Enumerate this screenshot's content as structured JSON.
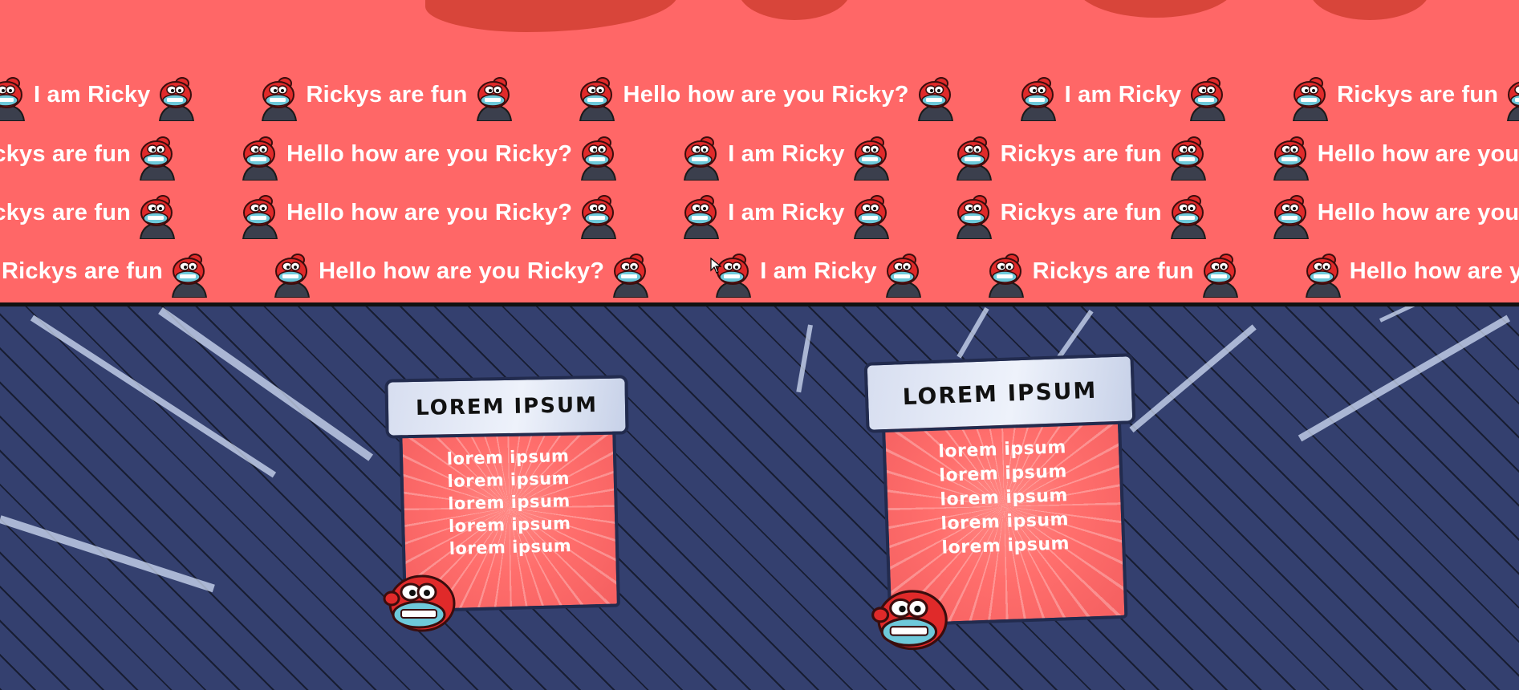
{
  "banner": {
    "phrases": [
      "I am Ricky",
      "Rickys are fun",
      "Hello how are you Ricky?"
    ],
    "rows": [
      [
        "I am Ricky",
        "Rickys are fun",
        "Hello how are you Ricky?",
        "I am Ricky",
        "Rickys are fun"
      ],
      [
        "Rickys are fun",
        "Hello how are you Ricky?",
        "I am Ricky",
        "Rickys are fun",
        "Hello how are you Ricky?"
      ],
      [
        "Rickys are fun",
        "Hello how are you Ricky?",
        "I am Ricky",
        "Rickys are fun",
        "Hello how are you Ricky?"
      ],
      [
        "Rickys are fun",
        "Hello how are you Ricky?",
        "I am Ricky",
        "Rickys are fun",
        "Hello how are you Ricky?"
      ]
    ]
  },
  "cards": [
    {
      "title": "LOREM IPSUM",
      "lines": [
        "lorem ipsum",
        "lorem ipsum",
        "lorem ipsum",
        "lorem ipsum",
        "lorem ipsum"
      ]
    },
    {
      "title": "LOREM IPSUM",
      "lines": [
        "lorem ipsum",
        "lorem ipsum",
        "lorem ipsum",
        "lorem ipsum",
        "lorem ipsum"
      ]
    }
  ],
  "colors": {
    "banner_bg": "#ff6767",
    "bottom_bg": "#34406f",
    "panel_red": "#ff6e6c",
    "mascot_red": "#e02a2a"
  }
}
